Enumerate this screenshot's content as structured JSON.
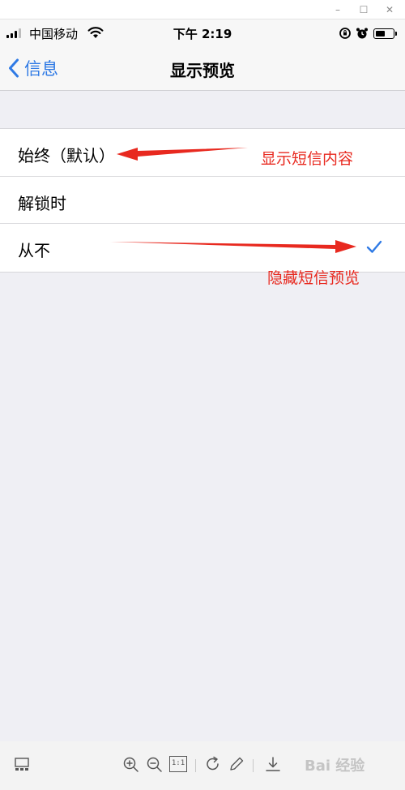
{
  "window_controls": {
    "minimize_glyph": "–",
    "maximize_glyph": "☐",
    "close_glyph": "✕"
  },
  "status_bar": {
    "carrier": "中国移动",
    "time": "下午 2:19",
    "battery_level": 0.55,
    "icons": [
      "signal-icon",
      "wifi-icon",
      "rotation-lock-icon",
      "alarm-icon",
      "battery-icon"
    ]
  },
  "nav": {
    "back_label": "信息",
    "title": "显示预览"
  },
  "options": [
    {
      "label": "始终（默认）",
      "selected": false
    },
    {
      "label": "解锁时",
      "selected": false
    },
    {
      "label": "从不",
      "selected": true
    }
  ],
  "annotations": {
    "show_content": "显示短信内容",
    "hide_preview": "隐藏短信预览",
    "color": "#e8291f"
  },
  "toolbar": {
    "icons": [
      "thumbnail-icon",
      "zoom-in-icon",
      "zoom-out-icon",
      "actual-size-icon",
      "rotate-icon",
      "edit-icon",
      "download-icon"
    ],
    "actual_size_label": "1:1",
    "watermark": "Bai 经验"
  },
  "colors": {
    "accent": "#2f7ae5",
    "background": "#efeff4"
  }
}
